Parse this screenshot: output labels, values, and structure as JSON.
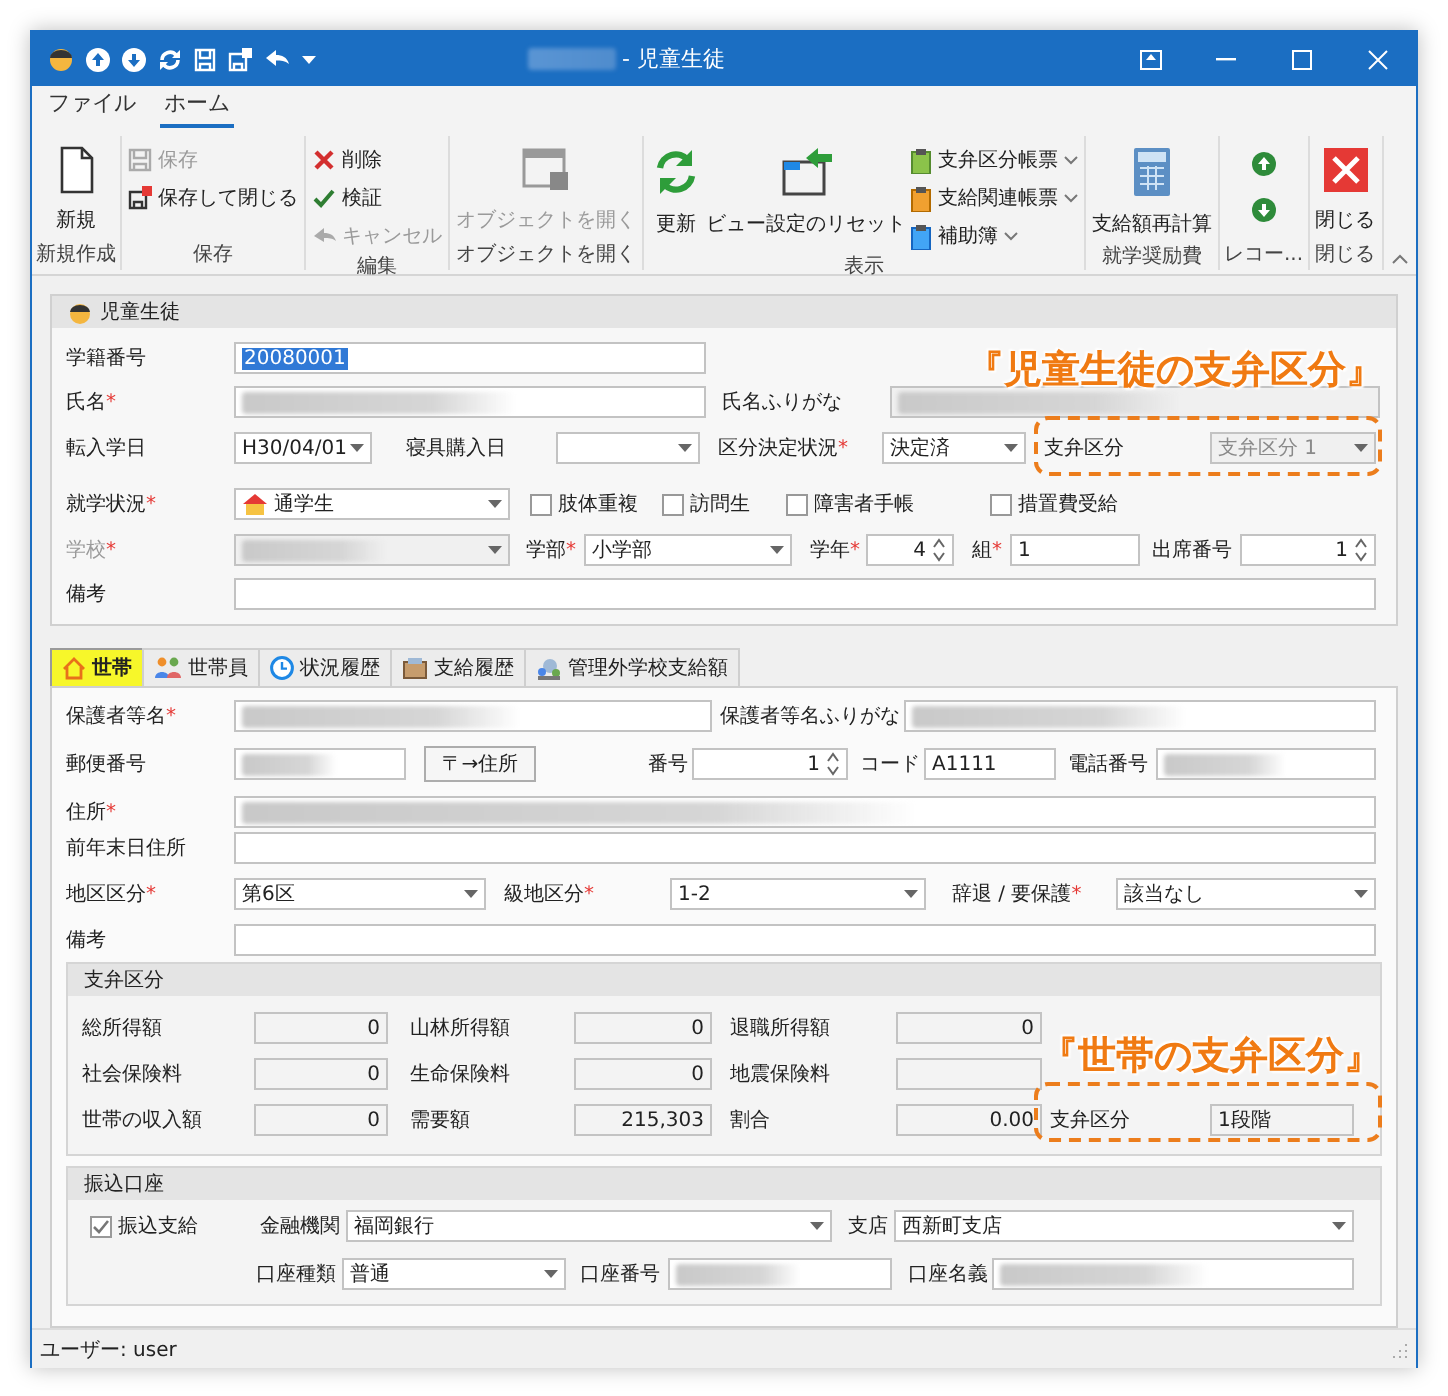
{
  "title_bar": {
    "title": "- 児童生徒"
  },
  "ribbon": {
    "tabs": [
      {
        "label": "ファイル",
        "selected": false
      },
      {
        "label": "ホーム",
        "selected": true
      }
    ],
    "groups": [
      {
        "label": "新規作成",
        "items": [
          {
            "kind": "large",
            "label": "新規",
            "disabled": false
          }
        ]
      },
      {
        "label": "保存",
        "items": [
          {
            "kind": "small",
            "label": "保存",
            "disabled": true
          },
          {
            "kind": "small",
            "label": "保存して閉じる",
            "disabled": false
          }
        ]
      },
      {
        "label": "編集",
        "items": [
          {
            "kind": "small",
            "label": "削除",
            "disabled": false
          },
          {
            "kind": "small",
            "label": "検証",
            "disabled": false
          },
          {
            "kind": "small",
            "label": "キャンセル",
            "disabled": true
          }
        ]
      },
      {
        "label": "オブジェクトを開く",
        "items": [
          {
            "kind": "large",
            "label": "オブジェクトを開く",
            "disabled": true
          }
        ]
      },
      {
        "label": "表示",
        "items": [
          {
            "kind": "large",
            "label": "更新",
            "disabled": false
          },
          {
            "kind": "large",
            "label": "ビュー設定のリセット",
            "disabled": false
          },
          {
            "kind": "menu",
            "label": "支弁区分帳票",
            "disabled": false
          },
          {
            "kind": "menu",
            "label": "支給関連帳票",
            "disabled": false
          },
          {
            "kind": "menu",
            "label": "補助簿",
            "disabled": false
          }
        ]
      },
      {
        "label": "就学奨励費",
        "items": [
          {
            "kind": "large",
            "label": "支給額再計算",
            "disabled": false
          }
        ]
      },
      {
        "label": "レコー...",
        "items": [
          {
            "kind": "icon",
            "disabled": false
          },
          {
            "kind": "icon",
            "disabled": false
          }
        ]
      },
      {
        "label": "閉じる",
        "items": [
          {
            "kind": "large",
            "label": "閉じる",
            "disabled": false
          }
        ]
      }
    ]
  },
  "student": {
    "header": "児童生徒",
    "rows": [
      {
        "fields": [
          {
            "kind": "label",
            "text": "学籍番号"
          },
          {
            "kind": "input",
            "value": "20080001",
            "highlighted": true,
            "disabled": false
          }
        ]
      },
      {
        "fields": [
          {
            "kind": "label",
            "text": "氏名",
            "required_mark": "*"
          },
          {
            "kind": "input",
            "blurred": true,
            "disabled": false
          },
          {
            "kind": "label",
            "text": "氏名ふりがな"
          },
          {
            "kind": "input",
            "blurred": true,
            "disabled": true
          }
        ]
      },
      {
        "fields": [
          {
            "kind": "label",
            "text": "転入学日"
          },
          {
            "kind": "select",
            "value": "H30/04/01",
            "disabled": false
          },
          {
            "kind": "label",
            "text": "寝具購入日"
          },
          {
            "kind": "select",
            "disabled": false
          },
          {
            "kind": "label",
            "text": "区分決定状況",
            "required_mark": "*"
          },
          {
            "kind": "select",
            "value": "決定済",
            "disabled": false
          },
          {
            "kind": "label",
            "text": "支弁区分"
          },
          {
            "kind": "select",
            "value": "支弁区分 1",
            "disabled": true
          }
        ]
      },
      {
        "fields": [
          {
            "kind": "label",
            "text": "就学状況",
            "required_mark": "*"
          },
          {
            "kind": "icon_select",
            "value": "通学生",
            "disabled": false
          },
          {
            "kind": "check",
            "text": "肢体重複",
            "checked": false
          },
          {
            "kind": "check",
            "text": "訪問生",
            "checked": false
          },
          {
            "kind": "check",
            "text": "障害者手帳",
            "checked": false
          },
          {
            "kind": "check",
            "text": "措置費受給",
            "checked": false
          }
        ]
      },
      {
        "fields": [
          {
            "kind": "label",
            "text": "学校",
            "required_mark": "*",
            "disabled": true
          },
          {
            "kind": "select",
            "blurred": true,
            "disabled": true
          },
          {
            "kind": "label",
            "text": "学部",
            "required_mark": "*"
          },
          {
            "kind": "select",
            "value": "小学部",
            "disabled": false
          },
          {
            "kind": "label",
            "text": "学年",
            "required_mark": "*"
          },
          {
            "kind": "spin",
            "value": "4"
          },
          {
            "kind": "label",
            "text": "組",
            "required_mark": "*"
          },
          {
            "kind": "input",
            "value": "1",
            "disabled": false
          },
          {
            "kind": "label",
            "text": "出席番号"
          },
          {
            "kind": "spin",
            "value": "1"
          }
        ]
      },
      {
        "fields": [
          {
            "kind": "label",
            "text": "備考"
          },
          {
            "kind": "input",
            "disabled": false
          }
        ]
      }
    ]
  },
  "tabs": [
    {
      "label": "世帯",
      "selected": true,
      "highlighted": true
    },
    {
      "label": "世帯員",
      "selected": false,
      "highlighted": false
    },
    {
      "label": "状況履歴",
      "selected": false,
      "highlighted": false
    },
    {
      "label": "支給履歴",
      "selected": false,
      "highlighted": false
    },
    {
      "label": "管理外学校支給額",
      "selected": false,
      "highlighted": false
    }
  ],
  "household": {
    "rows": [
      {
        "fields": [
          {
            "kind": "label",
            "text": "保護者等名",
            "required_mark": "*"
          },
          {
            "kind": "input",
            "blurred": true,
            "disabled": false
          },
          {
            "kind": "label",
            "text": "保護者等名ふりがな"
          },
          {
            "kind": "input",
            "blurred": true,
            "disabled": false
          }
        ]
      },
      {
        "fields": [
          {
            "kind": "label",
            "text": "郵便番号"
          },
          {
            "kind": "input",
            "blurred": true,
            "disabled": false
          },
          {
            "kind": "button",
            "text": "〒→住所"
          },
          {
            "kind": "label",
            "text": "番号"
          },
          {
            "kind": "spin",
            "value": "1"
          },
          {
            "kind": "label",
            "text": "コード"
          },
          {
            "kind": "input",
            "value": "A1111",
            "disabled": false
          },
          {
            "kind": "label",
            "text": "電話番号"
          },
          {
            "kind": "input",
            "blurred": true,
            "disabled": false
          }
        ]
      },
      {
        "fields": [
          {
            "kind": "label",
            "text": "住所",
            "required_mark": "*"
          },
          {
            "kind": "input",
            "blurred": true,
            "disabled": false
          }
        ]
      },
      {
        "fields": [
          {
            "kind": "label",
            "text": "前年末日住所"
          },
          {
            "kind": "input",
            "disabled": false
          }
        ]
      },
      {
        "fields": [
          {
            "kind": "label",
            "text": "地区区分",
            "required_mark": "*"
          },
          {
            "kind": "select",
            "value": "第6区",
            "disabled": false
          },
          {
            "kind": "label",
            "text": "級地区分",
            "required_mark": "*"
          },
          {
            "kind": "select",
            "value": "1-2",
            "disabled": false
          },
          {
            "kind": "label",
            "text": "辞退 / 要保護",
            "required_mark": "*"
          },
          {
            "kind": "select",
            "value": "該当なし",
            "disabled": false
          }
        ]
      },
      {
        "fields": [
          {
            "kind": "label",
            "text": "備考"
          },
          {
            "kind": "input",
            "disabled": false
          }
        ]
      }
    ],
    "panels": [
      {
        "header": "支弁区分",
        "rows": [
          {
            "fields": [
              {
                "kind": "label",
                "text": "総所得額"
              },
              {
                "kind": "number",
                "value": "0"
              },
              {
                "kind": "label",
                "text": "山林所得額"
              },
              {
                "kind": "number",
                "value": "0"
              },
              {
                "kind": "label",
                "text": "退職所得額"
              },
              {
                "kind": "number",
                "value": "0"
              }
            ]
          },
          {
            "fields": [
              {
                "kind": "label",
                "text": "社会保険料"
              },
              {
                "kind": "number",
                "value": "0"
              },
              {
                "kind": "label",
                "text": "生命保険料"
              },
              {
                "kind": "number",
                "value": "0"
              },
              {
                "kind": "label",
                "text": "地震保険料"
              },
              {
                "kind": "number"
              }
            ]
          },
          {
            "fields": [
              {
                "kind": "label",
                "text": "世帯の収入額"
              },
              {
                "kind": "number",
                "value": "0"
              },
              {
                "kind": "label",
                "text": "需要額"
              },
              {
                "kind": "number",
                "value": "215,303"
              },
              {
                "kind": "label",
                "text": "割合"
              },
              {
                "kind": "number",
                "value": "0.00"
              },
              {
                "kind": "label",
                "text": "支弁区分"
              },
              {
                "kind": "readonly",
                "value": "1段階"
              }
            ]
          }
        ]
      },
      {
        "header": "振込口座",
        "rows": [
          {
            "fields": [
              {
                "kind": "check",
                "text": "振込支給",
                "checked": true
              },
              {
                "kind": "label",
                "text": "金融機関"
              },
              {
                "kind": "select",
                "value": "福岡銀行",
                "disabled": false
              },
              {
                "kind": "label",
                "text": "支店"
              },
              {
                "kind": "select",
                "value": "西新町支店",
                "disabled": false
              }
            ]
          },
          {
            "fields": [
              {
                "kind": "label",
                "text": "口座種類"
              },
              {
                "kind": "select",
                "value": "普通",
                "disabled": false
              },
              {
                "kind": "label",
                "text": "口座番号"
              },
              {
                "kind": "input",
                "blurred": true,
                "disabled": false
              },
              {
                "kind": "label",
                "text": "口座名義"
              },
              {
                "kind": "input",
                "blurred": true,
                "disabled": false
              }
            ]
          }
        ]
      }
    ]
  },
  "annotations": [
    {
      "kind": "callout",
      "text": "『児童生徒の支弁区分』"
    },
    {
      "kind": "dashed_box"
    },
    {
      "kind": "callout",
      "text": "『世帯の支弁区分』"
    },
    {
      "kind": "dashed_box"
    }
  ],
  "status_bar": {
    "text": "ユーザー: user"
  }
}
